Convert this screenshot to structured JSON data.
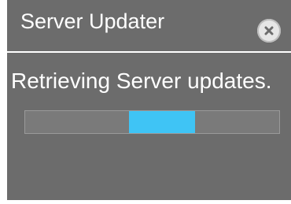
{
  "window": {
    "title": "Server Updater",
    "close_icon": "close-circle-icon"
  },
  "status": {
    "message": "Retrieving Server updates.",
    "progress": {
      "type": "indeterminate",
      "segment_start": 0.41,
      "segment_end": 0.67
    }
  },
  "colors": {
    "dialog_background": "#6c6c6c",
    "text": "#ffffff",
    "progress_track": "#7a7a7a",
    "progress_fill": "#3fc4f5",
    "close_button": "#e6e6e6"
  }
}
